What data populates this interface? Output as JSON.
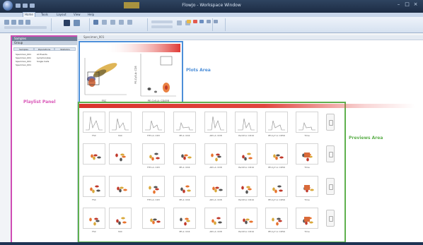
{
  "window": {
    "title": "FlowJo - Workspace Window"
  },
  "ribbon": {
    "tabs": [
      "Home",
      "Tools",
      "Layout",
      "View",
      "Help"
    ]
  },
  "playlist_panel": {
    "header": "Samples",
    "subheader": "Group",
    "tabs": [
      "Samples",
      "Populations",
      "Statistics"
    ],
    "rows": [
      {
        "name": "Specimen_001",
        "value": "All Events"
      },
      {
        "name": "Specimen_001",
        "value": "Lymphocytes"
      },
      {
        "name": "Specimen_001",
        "value": "Single Cells"
      },
      {
        "name": "Specimen_001",
        "value": ""
      }
    ]
  },
  "document": {
    "tab_label": "Specimen_001"
  },
  "annotations": {
    "playlist_panel": "Playlist Panel",
    "plots_area": "Plots Area",
    "previews_area": "Previews Area"
  },
  "plots": {
    "left_x_label": "FSC",
    "right_y_label": "PE-Cy5-A: CD5",
    "right_x_label": "PE-Cy5-A: CD45R"
  },
  "previews": {
    "rows": [
      [
        "FSC",
        "SSC",
        "FITC-A: CD3",
        "PE-A: CD4",
        "APC-A: CD8",
        "PerCP-A: CD19",
        "PE-Cy7-A: CD56",
        "Time"
      ],
      [
        "",
        "",
        "FITC-A: CD3",
        "PE-A: CD4",
        "APC-A: CD8",
        "PerCP-A: CD19",
        "PE-Cy7-A: CD56",
        "Time"
      ],
      [
        "FSC",
        "",
        "FITC-A: CD3",
        "PE-A: CD4",
        "APC-A: CD8",
        "PerCP-A: CD19",
        "PE-Cy7-A: CD56",
        "Time"
      ],
      [
        "FSC",
        "SSC",
        "",
        "PE-A: CD4",
        "APC-A: CD8",
        "PerCP-A: CD19",
        "PE-Cy7-A: CD56",
        "Time"
      ]
    ]
  },
  "colors": {
    "playlist_border": "#cf4cb4",
    "plots_border": "#4d8fd9",
    "previews_border": "#5fb04e",
    "annotation_pink": "#d957b8",
    "annotation_blue": "#4d8fd9",
    "annotation_green": "#5fb04e"
  }
}
